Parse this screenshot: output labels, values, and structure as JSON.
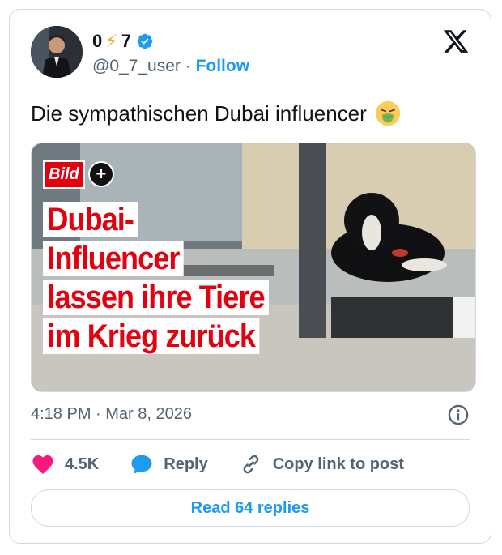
{
  "author": {
    "display_name_prefix": "0",
    "display_name_emoji": "⚡",
    "display_name_suffix": "7",
    "handle": "@0_7_user",
    "separator": " · ",
    "follow_label": "Follow"
  },
  "tweet": {
    "text": "Die sympathischen Dubai influencer",
    "text_emoji": "nauseated-face-icon"
  },
  "media": {
    "brand_logo_text": "Bild",
    "brand_logo_plus": "+",
    "headline_lines": [
      "Dubai-",
      "Influencer",
      "lassen ihre Tiere",
      "im Krieg zurück"
    ]
  },
  "meta": {
    "timestamp": "4:18 PM · Mar 8, 2026"
  },
  "actions": {
    "like_count": "4.5K",
    "reply_label": "Reply",
    "copy_label": "Copy link to post"
  },
  "footer": {
    "read_replies_label": "Read 64 replies"
  },
  "colors": {
    "accent": "#1d9bf0",
    "like": "#f91880",
    "headline_red": "#e3000f"
  }
}
